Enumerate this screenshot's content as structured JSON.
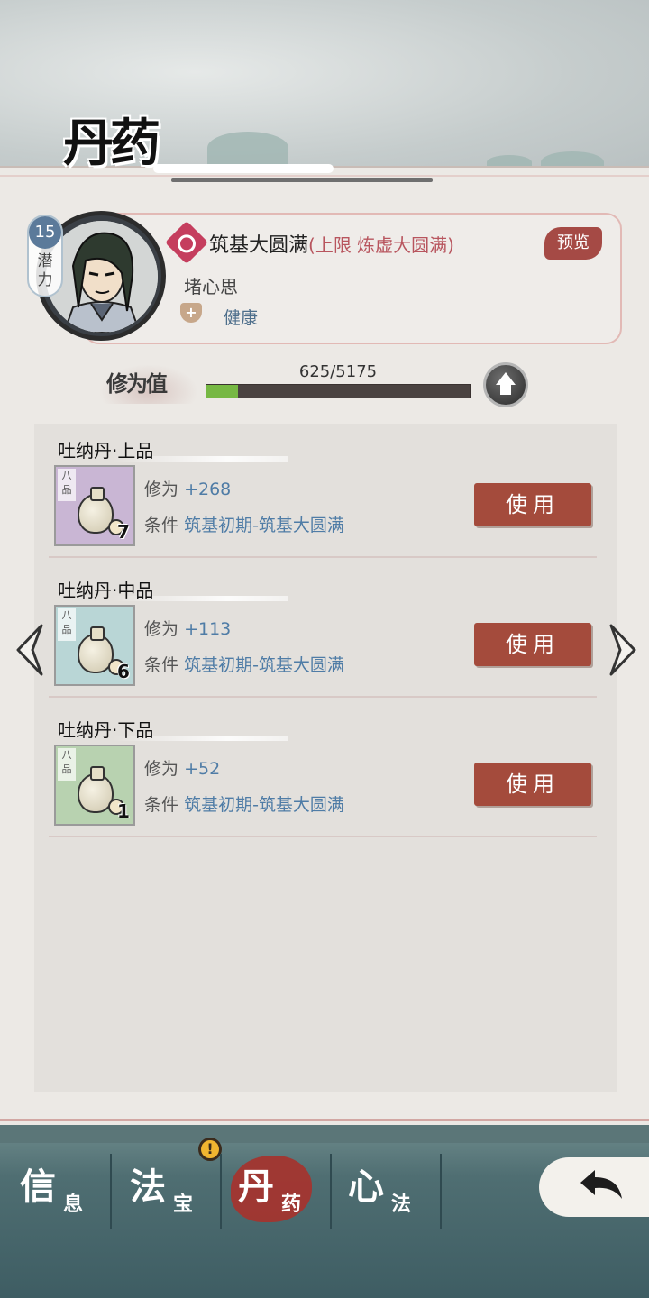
{
  "page": {
    "title": "丹药"
  },
  "character": {
    "level": "15",
    "level_label": "潜力",
    "realm": "筑基大圆满",
    "realm_limit": "(上限 炼虚大圆满)",
    "preview_label": "预览",
    "trait": "堵心思",
    "health": "健康"
  },
  "cultivation": {
    "label": "修为值",
    "value_text": "625/5175",
    "current": 625,
    "max": 5175
  },
  "pills": [
    {
      "name": "吐纳丹·上品",
      "grade": "八品",
      "count": "7",
      "stat_label": "修为",
      "stat_value": "+268",
      "cond_label": "条件",
      "cond_value": "筑基初期-筑基大圆满",
      "use_label": "使用",
      "bg_color": "#c9b6d4"
    },
    {
      "name": "吐纳丹·中品",
      "grade": "八品",
      "count": "6",
      "stat_label": "修为",
      "stat_value": "+113",
      "cond_label": "条件",
      "cond_value": "筑基初期-筑基大圆满",
      "use_label": "使用",
      "bg_color": "#b9d6d6"
    },
    {
      "name": "吐纳丹·下品",
      "grade": "八品",
      "count": "1",
      "stat_label": "修为",
      "stat_value": "+52",
      "cond_label": "条件",
      "cond_value": "筑基初期-筑基大圆满",
      "use_label": "使用",
      "bg_color": "#b8d2b0"
    }
  ],
  "nav": {
    "tabs": [
      {
        "big": "信",
        "small": "息"
      },
      {
        "big": "法",
        "small": "宝"
      },
      {
        "big": "丹",
        "small": "药"
      },
      {
        "big": "心",
        "small": "法"
      }
    ],
    "alert_badge": "!"
  },
  "colors": {
    "accent_red": "#a44b3c",
    "progress_green": "#76b843",
    "stat_blue": "#4f7ca6"
  }
}
